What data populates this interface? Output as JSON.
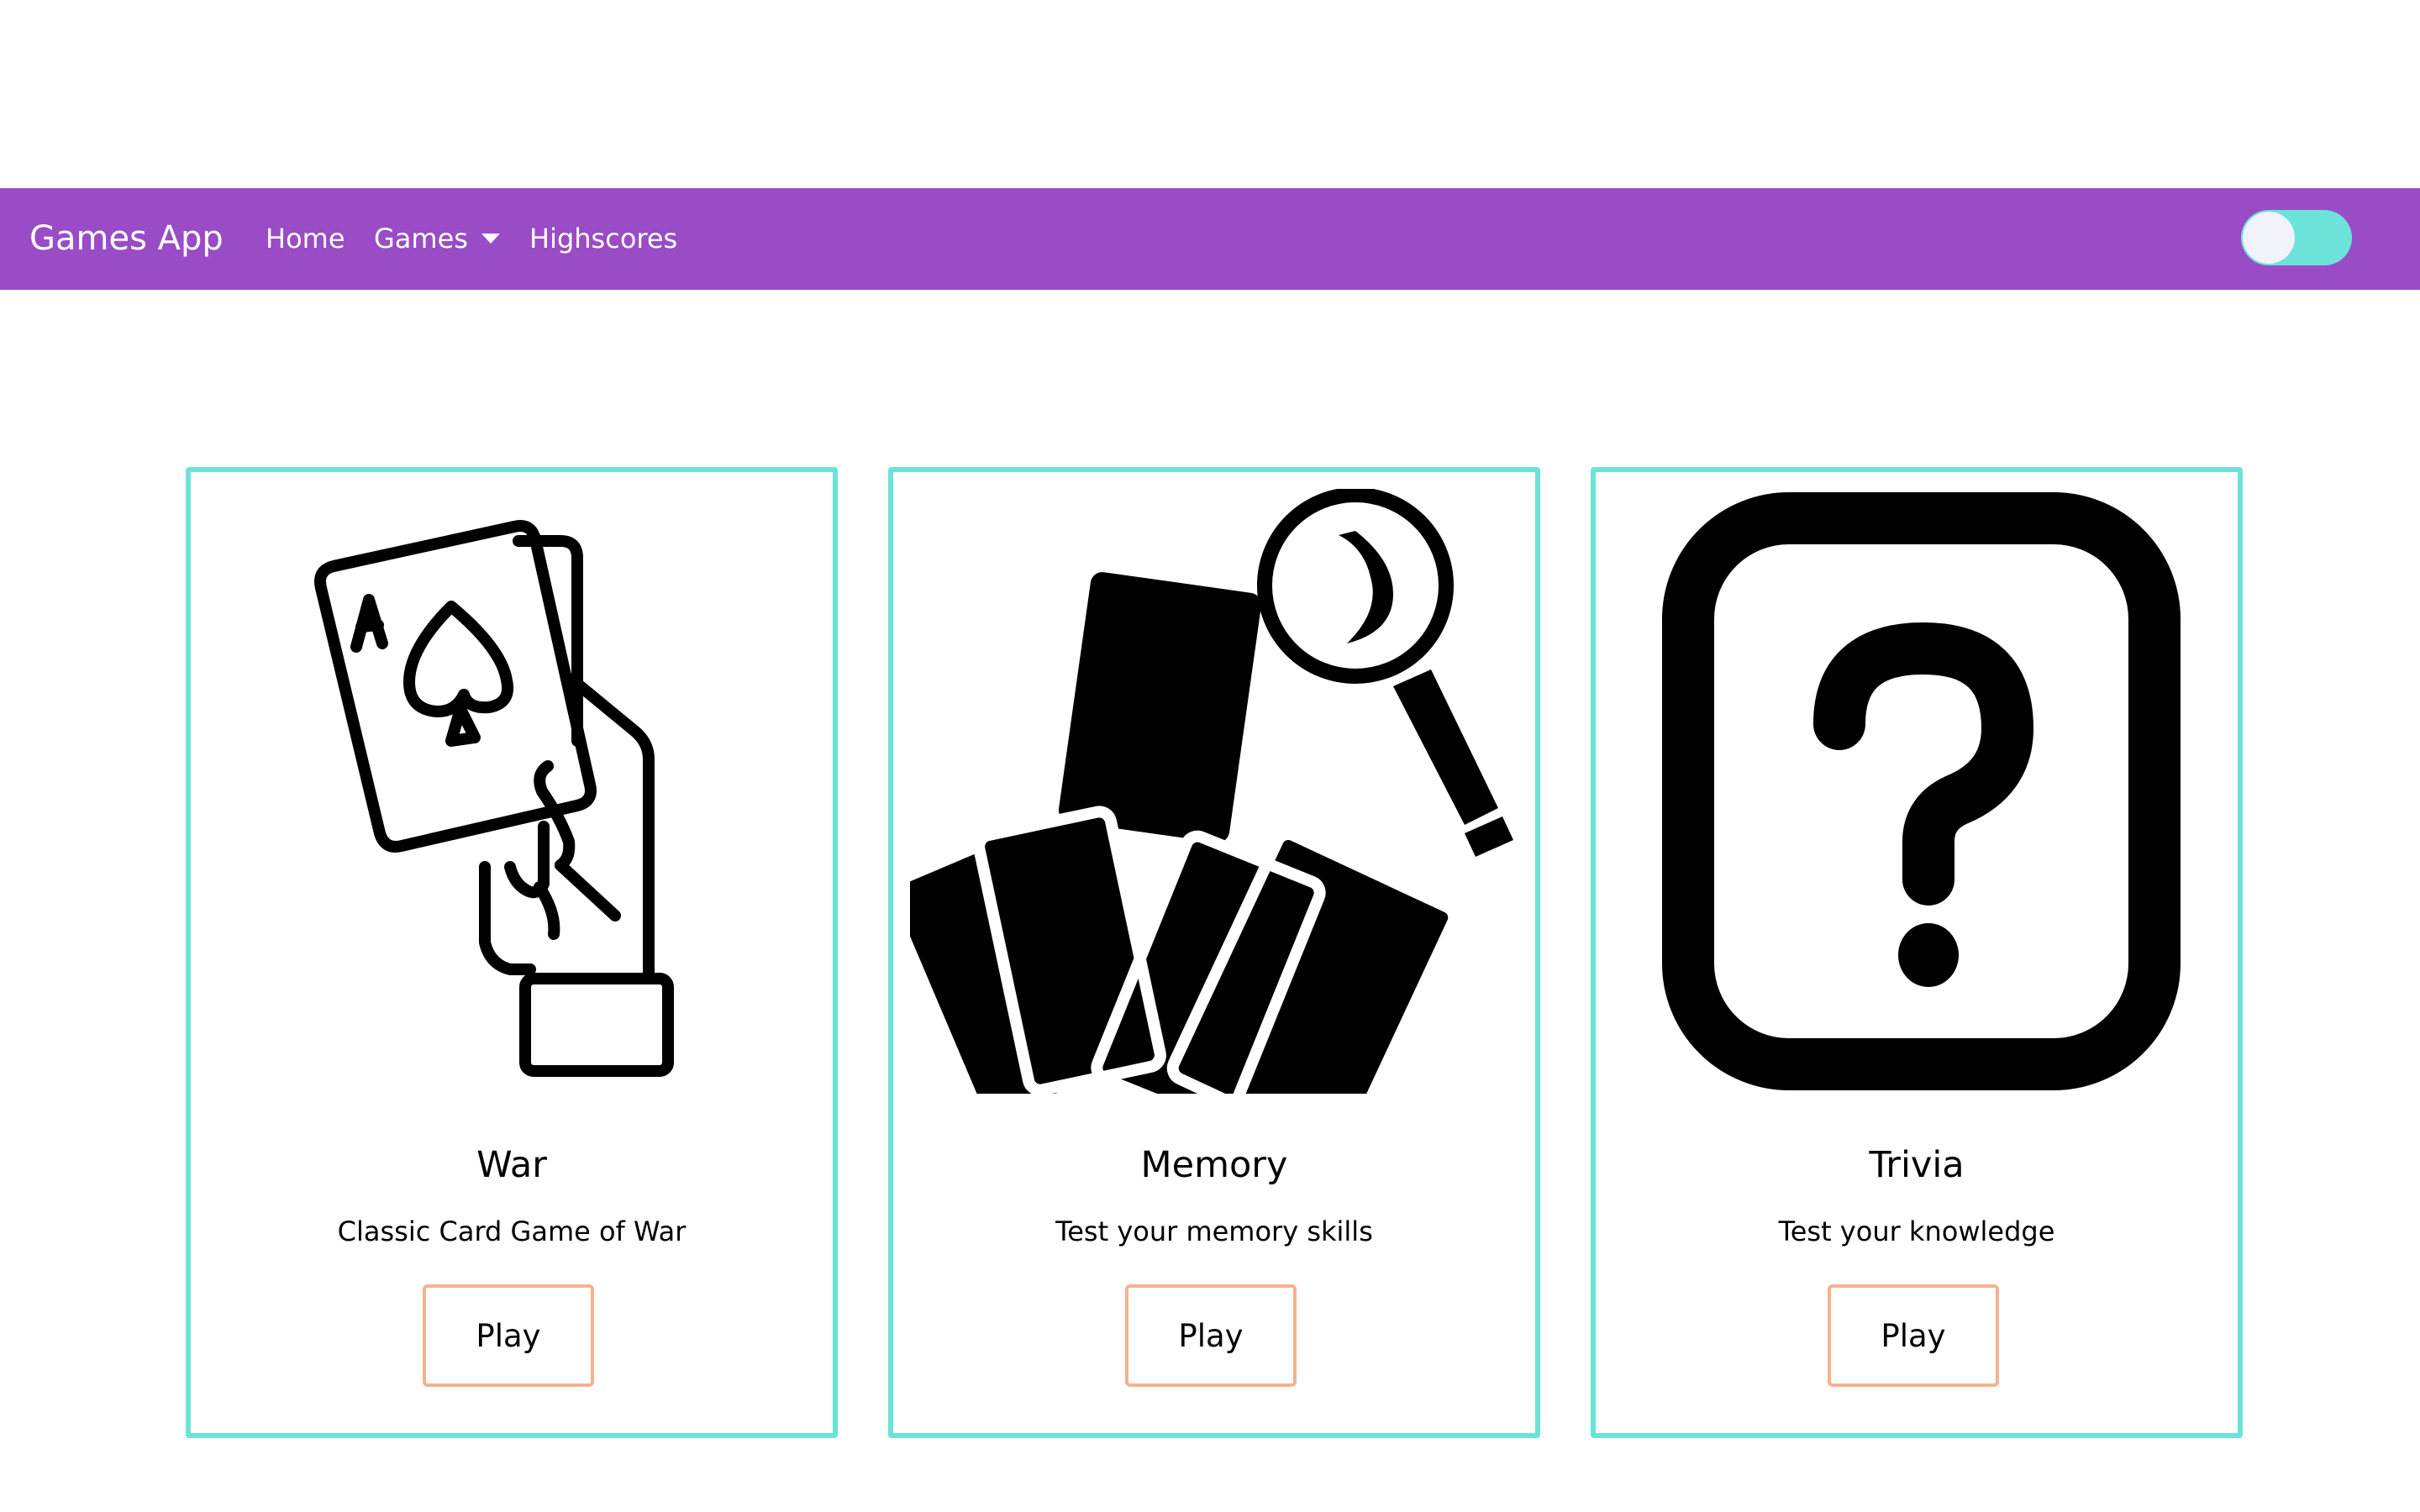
{
  "navbar": {
    "brand": "Games App",
    "links": [
      {
        "label": "Home"
      },
      {
        "label": "Games"
      },
      {
        "label": "Highscores"
      }
    ],
    "color": "#994cc5"
  },
  "theme_toggle": {
    "state": "on",
    "track_color": "#6be3d9",
    "knob_color": "#f1f2fb"
  },
  "cards": [
    {
      "title": "War",
      "description": "Classic Card Game of War",
      "button": "Play",
      "icon": "hand-holding-cards-icon"
    },
    {
      "title": "Memory",
      "description": "Test your memory skills",
      "button": "Play",
      "icon": "cards-magnifier-icon"
    },
    {
      "title": "Trivia",
      "description": "Test your knowledge",
      "button": "Play",
      "icon": "question-mark-icon"
    }
  ],
  "colors": {
    "card_border": "#6be3d9",
    "button_border": "#f4b28f"
  }
}
